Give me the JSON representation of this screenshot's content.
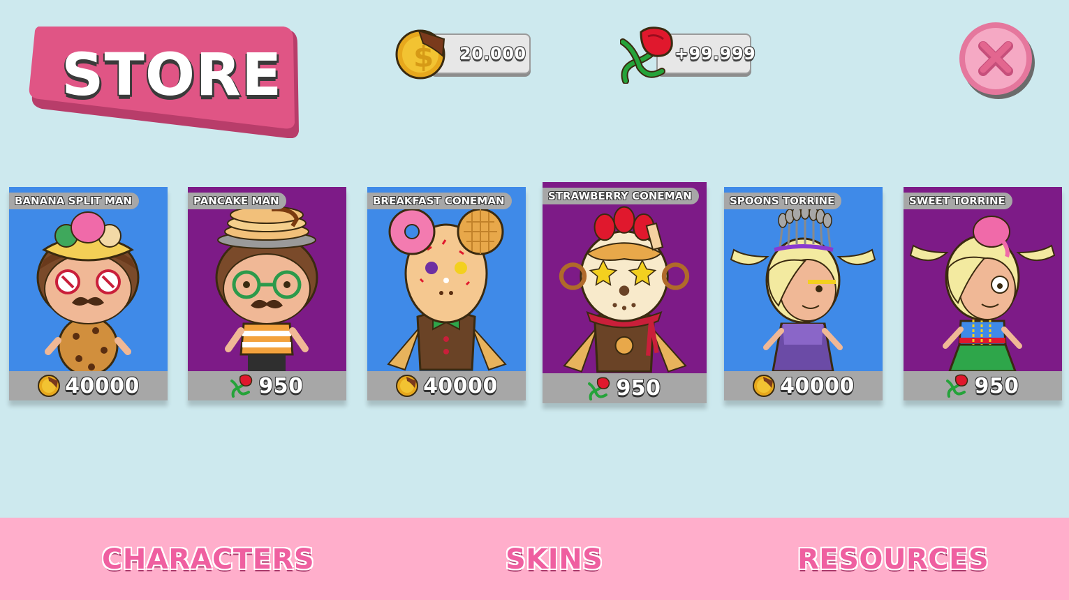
{
  "header": {
    "title": "STORE",
    "coins": "20.000",
    "roses": "+99.999",
    "close_icon": "close-icon"
  },
  "colors": {
    "background": "#cde9ee",
    "banner_pink": "#e05585",
    "card_blue": "#3f8ae8",
    "card_purple": "#7d1b87",
    "nav_pink": "#ffaecb",
    "nav_text": "#ef5fa0"
  },
  "cards": [
    {
      "name": "BANANA SPLIT MAN",
      "price": "40000",
      "currency": "coin",
      "bg": "blue"
    },
    {
      "name": "PANCAKE MAN",
      "price": "950",
      "currency": "rose",
      "bg": "purple"
    },
    {
      "name": "BREAKFAST CONEMAN",
      "price": "40000",
      "currency": "coin",
      "bg": "blue"
    },
    {
      "name": "STRAWBERRY CONEMAN",
      "price": "950",
      "currency": "rose",
      "bg": "purple"
    },
    {
      "name": "SPOONS TORRINE",
      "price": "40000",
      "currency": "coin",
      "bg": "blue"
    },
    {
      "name": "SWEET TORRINE",
      "price": "950",
      "currency": "rose",
      "bg": "purple"
    }
  ],
  "nav": {
    "characters": "CHARACTERS",
    "skins": "SKINS",
    "resources": "RESOURCES"
  }
}
